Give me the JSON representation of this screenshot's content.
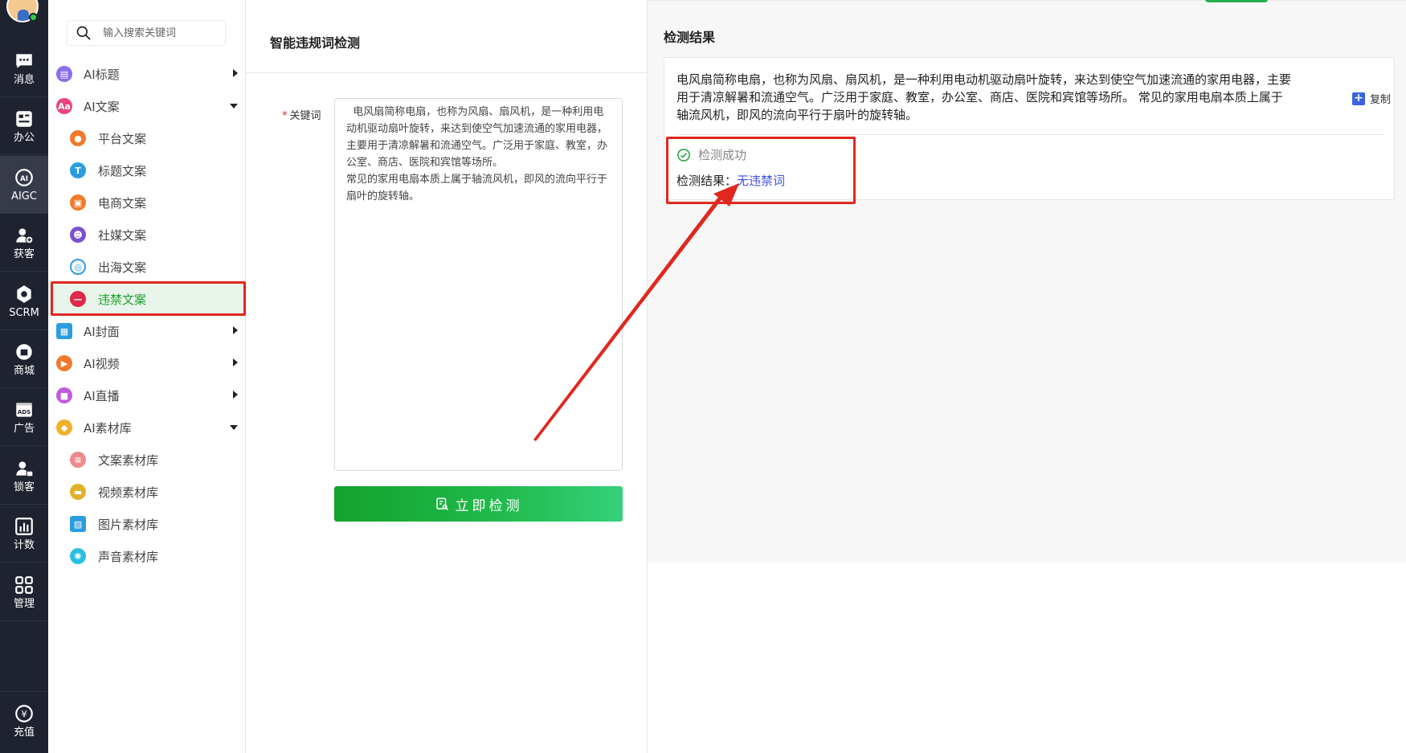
{
  "rail": {
    "items": [
      {
        "label": "消息",
        "icon": "message-icon"
      },
      {
        "label": "办公",
        "icon": "office-icon"
      },
      {
        "label": "AIGC",
        "icon": "ai-icon"
      },
      {
        "label": "获客",
        "icon": "user-add-icon"
      },
      {
        "label": "SCRM",
        "icon": "scrm-icon"
      },
      {
        "label": "商城",
        "icon": "shop-icon"
      },
      {
        "label": "广告",
        "icon": "ads-icon"
      },
      {
        "label": "锁客",
        "icon": "user-lock-icon"
      },
      {
        "label": "计数",
        "icon": "bar-chart-icon"
      },
      {
        "label": "管理",
        "icon": "grid-icon"
      },
      {
        "label": "充值",
        "icon": "yen-icon"
      }
    ]
  },
  "menu": {
    "search_placeholder": "输入搜索关键词",
    "items": [
      {
        "label": "AI标题",
        "color": "#8a6fe8",
        "icon": "title-icon"
      },
      {
        "label": "AI文案",
        "color": "#e8457a",
        "icon": "text-icon"
      },
      {
        "label": "平台文案",
        "color": "#f07a2a",
        "icon": "platform-icon"
      },
      {
        "label": "标题文案",
        "color": "#2a9de0",
        "icon": "t-icon"
      },
      {
        "label": "电商文案",
        "color": "#f07a2a",
        "icon": "shop-bag-icon"
      },
      {
        "label": "社媒文案",
        "color": "#7a4fd0",
        "icon": "people-icon"
      },
      {
        "label": "出海文案",
        "color": "#2a9de0",
        "icon": "globe-icon"
      },
      {
        "label": "违禁文案",
        "color": "#e0284a",
        "icon": "forbidden-icon"
      },
      {
        "label": "AI封面",
        "color": "#2a9de0",
        "icon": "picture-icon"
      },
      {
        "label": "AI视频",
        "color": "#f07a2a",
        "icon": "video-icon"
      },
      {
        "label": "AI直播",
        "color": "#c05ae0",
        "icon": "camera-icon"
      },
      {
        "label": "AI素材库",
        "color": "#f0b02a",
        "icon": "library-icon"
      },
      {
        "label": "文案素材库",
        "color": "#f08a8a",
        "icon": "doc-icon"
      },
      {
        "label": "视频素材库",
        "color": "#e0b02a",
        "icon": "film-icon"
      },
      {
        "label": "图片素材库",
        "color": "#2a9de0",
        "icon": "image-icon"
      },
      {
        "label": "声音素材库",
        "color": "#2ac0e0",
        "icon": "sound-icon"
      }
    ]
  },
  "form": {
    "title": "智能违规词检测",
    "keyword_label": "关键词",
    "required_mark": "*",
    "keyword_value": "  电风扇简称电扇，也称为风扇、扇风机，是一种利用电动机驱动扇叶旋转，来达到使空气加速流通的家用电器，主要用于清凉解暑和流通空气。广泛用于家庭、教室，办公室、商店、医院和宾馆等场所。\n常见的家用电扇本质上属于轴流风机，即风的流向平行于扇叶的旋转轴。",
    "button_label": "立即检测"
  },
  "result": {
    "title": "检测结果",
    "text_line1": "电风扇简称电扇，也称为风扇、扇风机，是一种利用电动机驱动扇叶旋转，来达到使空气加速流通的家用电器，主要",
    "text_line2": "用于清凉解暑和流通空气。广泛用于家庭、教室，办公室、商店、医院和宾馆等场所。 常见的家用电扇本质上属于",
    "text_line3": "轴流风机，即风的流向平行于扇叶的旋转轴。",
    "copy_label": "复制",
    "status": "检测成功",
    "verdict_label": "检测结果：",
    "verdict_value": "无违禁词"
  },
  "colors": {
    "accent_green": "#1fa02d",
    "highlight_red": "#e0281f",
    "link_blue": "#3f51e4"
  }
}
